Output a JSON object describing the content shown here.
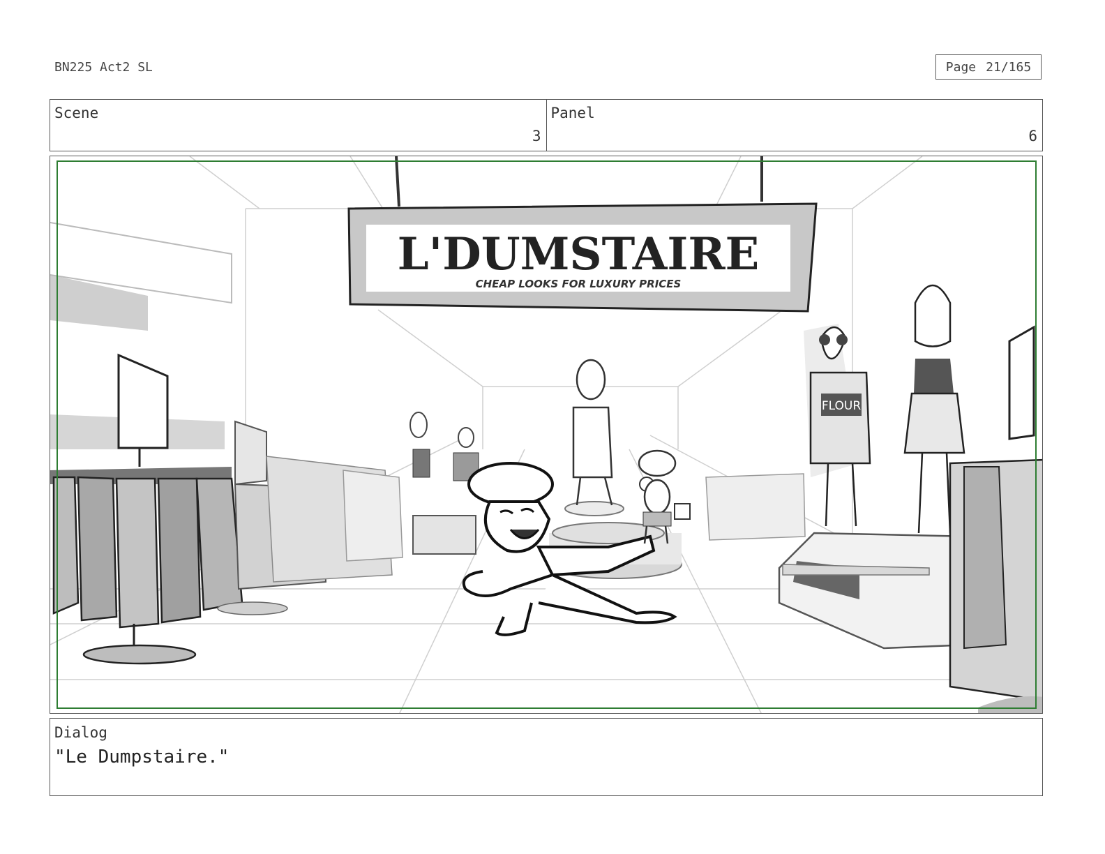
{
  "header": {
    "doc_title": "BN225 Act2 SL",
    "page_label": "Page",
    "page_number": "21/165"
  },
  "info_row": {
    "scene_label": "Scene",
    "scene_value": "3",
    "panel_label": "Panel",
    "panel_value": "6"
  },
  "drawing": {
    "sign_title": "L'DUMSTAIRE",
    "sign_subtitle": "CHEAP LOOKS FOR LUXURY PRICES",
    "shirt_text": "FLOUR",
    "safe_area_color": "#2e7d32"
  },
  "dialog": {
    "label": "Dialog",
    "text": "\"Le Dumpstaire.\""
  }
}
